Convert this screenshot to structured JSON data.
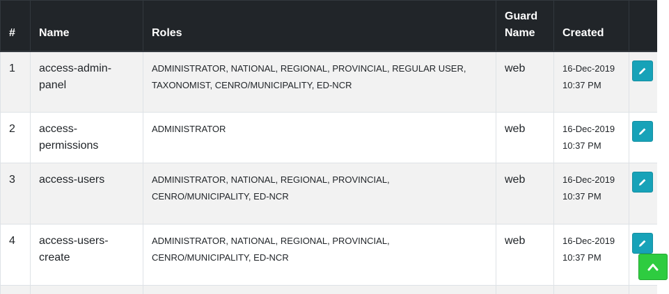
{
  "table": {
    "headers": {
      "num": "#",
      "name": "Name",
      "roles": "Roles",
      "guard_line1": "Guard",
      "guard_line2": "Name",
      "created": "Created"
    },
    "rows": [
      {
        "num": "1",
        "name": "access-admin-panel",
        "roles": "ADMINISTRATOR, NATIONAL, REGIONAL, PROVINCIAL, REGULAR USER, TAXONOMIST, CENRO/MUNICIPALITY, ED-NCR",
        "guard": "web",
        "created_date": "16-Dec-2019",
        "created_time": "10:37 PM"
      },
      {
        "num": "2",
        "name": "access-permissions",
        "roles": "ADMINISTRATOR",
        "guard": "web",
        "created_date": "16-Dec-2019",
        "created_time": "10:37 PM"
      },
      {
        "num": "3",
        "name": "access-users",
        "roles": "ADMINISTRATOR, NATIONAL, REGIONAL, PROVINCIAL, CENRO/MUNICIPALITY, ED-NCR",
        "guard": "web",
        "created_date": "16-Dec-2019",
        "created_time": "10:37 PM"
      },
      {
        "num": "4",
        "name": "access-users-create",
        "roles": "ADMINISTRATOR, NATIONAL, REGIONAL, PROVINCIAL, CENRO/MUNICIPALITY, ED-NCR",
        "guard": "web",
        "created_date": "16-Dec-2019",
        "created_time": "10:37 PM"
      }
    ]
  },
  "icons": {
    "edit": "pencil-icon",
    "back_to_top": "chevron-up-icon"
  },
  "colors": {
    "header_bg": "#212529",
    "edit_button": "#17a2b8",
    "back_to_top": "#2ecc40"
  }
}
